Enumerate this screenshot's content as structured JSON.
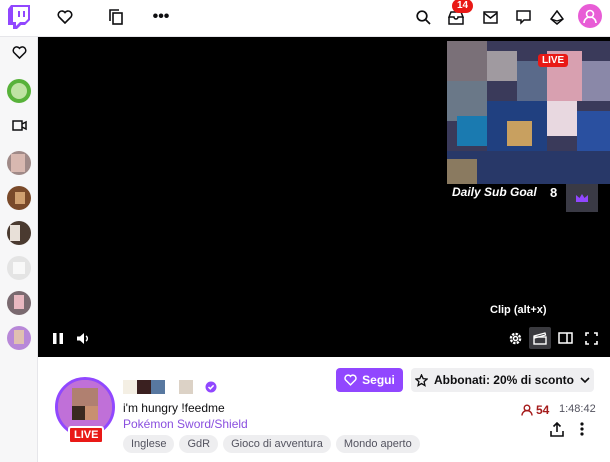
{
  "topbar": {
    "notifications_count": "14"
  },
  "player": {
    "mini_live_label": "LIVE",
    "goal_label": "Daily Sub Goal",
    "goal_count": "8",
    "clip_tooltip": "Clip (alt+x)"
  },
  "channel": {
    "live_label": "LIVE",
    "title": "i'm hungry !feedme",
    "game": "Pokémon Sword/Shield",
    "tags": [
      "Inglese",
      "GdR",
      "Gioco di avventura",
      "Mondo aperto"
    ],
    "follow_label": "Segui",
    "subscribe_label": "Abbonati: 20% di sconto",
    "viewers": "54",
    "uptime": "1:48:42"
  },
  "colors": {
    "brand": "#9147ff",
    "live": "#e91916",
    "viewers": "#a51b1b"
  }
}
